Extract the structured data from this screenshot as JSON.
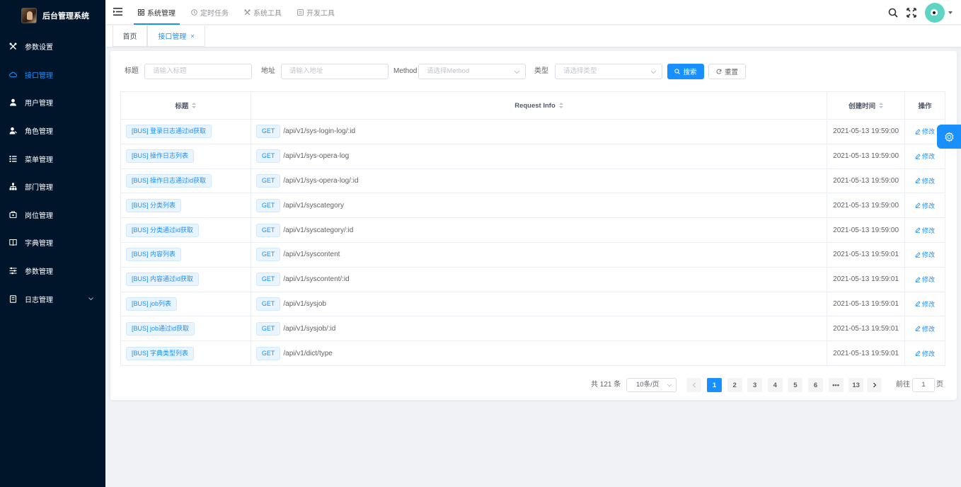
{
  "app": {
    "title": "后台管理系统"
  },
  "sidebar": {
    "items": [
      {
        "label": "参数设置",
        "icon": "tools-icon",
        "active": false
      },
      {
        "label": "接口管理",
        "icon": "cloud-icon",
        "active": true
      },
      {
        "label": "用户管理",
        "icon": "user-icon",
        "active": false
      },
      {
        "label": "角色管理",
        "icon": "role-icon",
        "active": false
      },
      {
        "label": "菜单管理",
        "icon": "menu-list-icon",
        "active": false
      },
      {
        "label": "部门管理",
        "icon": "tree-icon",
        "active": false
      },
      {
        "label": "岗位管理",
        "icon": "post-icon",
        "active": false
      },
      {
        "label": "字典管理",
        "icon": "book-icon",
        "active": false
      },
      {
        "label": "参数管理",
        "icon": "sliders-icon",
        "active": false
      },
      {
        "label": "日志管理",
        "icon": "log-icon",
        "active": false,
        "expandable": true
      }
    ]
  },
  "topnav": {
    "items": [
      {
        "label": "系统管理",
        "icon": "grid-icon",
        "active": true
      },
      {
        "label": "定时任务",
        "icon": "clock-icon",
        "active": false
      },
      {
        "label": "系统工具",
        "icon": "tools-icon",
        "active": false
      },
      {
        "label": "开发工具",
        "icon": "code-icon",
        "active": false
      }
    ]
  },
  "tabs": [
    {
      "label": "首页",
      "active": false
    },
    {
      "label": "接口管理",
      "active": true,
      "closable": true,
      "close": "×"
    }
  ],
  "filters": {
    "title_label": "标题",
    "title_placeholder": "请输入标题",
    "path_label": "地址",
    "path_placeholder": "请输入地址",
    "method_label": "Method",
    "method_placeholder": "请选择Method",
    "type_label": "类型",
    "type_placeholder": "请选择类型",
    "search_label": "搜索",
    "reset_label": "重置"
  },
  "table": {
    "headers": {
      "title": "标题",
      "request": "Request Info",
      "created": "创建时间",
      "action": "操作"
    },
    "rows": [
      {
        "title": "[BUS] 登录日志通过id获取",
        "method": "GET",
        "path": "/api/v1/sys-login-log/:id",
        "created": "2021-05-13 19:59:00",
        "action": "修改"
      },
      {
        "title": "[BUS] 操作日志列表",
        "method": "GET",
        "path": "/api/v1/sys-opera-log",
        "created": "2021-05-13 19:59:00",
        "action": "修改"
      },
      {
        "title": "[BUS] 操作日志通过id获取",
        "method": "GET",
        "path": "/api/v1/sys-opera-log/:id",
        "created": "2021-05-13 19:59:00",
        "action": "修改"
      },
      {
        "title": "[BUS] 分类列表",
        "method": "GET",
        "path": "/api/v1/syscategory",
        "created": "2021-05-13 19:59:00",
        "action": "修改"
      },
      {
        "title": "[BUS] 分类通过id获取",
        "method": "GET",
        "path": "/api/v1/syscategory/:id",
        "created": "2021-05-13 19:59:00",
        "action": "修改"
      },
      {
        "title": "[BUS] 内容列表",
        "method": "GET",
        "path": "/api/v1/syscontent",
        "created": "2021-05-13 19:59:01",
        "action": "修改"
      },
      {
        "title": "[BUS] 内容通过id获取",
        "method": "GET",
        "path": "/api/v1/syscontent/:id",
        "created": "2021-05-13 19:59:01",
        "action": "修改"
      },
      {
        "title": "[BUS] job列表",
        "method": "GET",
        "path": "/api/v1/sysjob",
        "created": "2021-05-13 19:59:01",
        "action": "修改"
      },
      {
        "title": "[BUS] job通过id获取",
        "method": "GET",
        "path": "/api/v1/sysjob/:id",
        "created": "2021-05-13 19:59:01",
        "action": "修改"
      },
      {
        "title": "[BUS] 字典类型列表",
        "method": "GET",
        "path": "/api/v1/dict/type",
        "created": "2021-05-13 19:59:01",
        "action": "修改"
      }
    ]
  },
  "pagination": {
    "total_text": "共 121 条",
    "page_size": "10条/页",
    "pages": [
      "1",
      "2",
      "3",
      "4",
      "5",
      "6",
      "•••",
      "13"
    ],
    "current": "1",
    "goto_label": "前往",
    "goto_value": "1",
    "goto_unit": "页"
  },
  "colors": {
    "accent": "#1890ff",
    "sidebar_bg": "#001529",
    "page_bg": "#f0f2f5"
  }
}
